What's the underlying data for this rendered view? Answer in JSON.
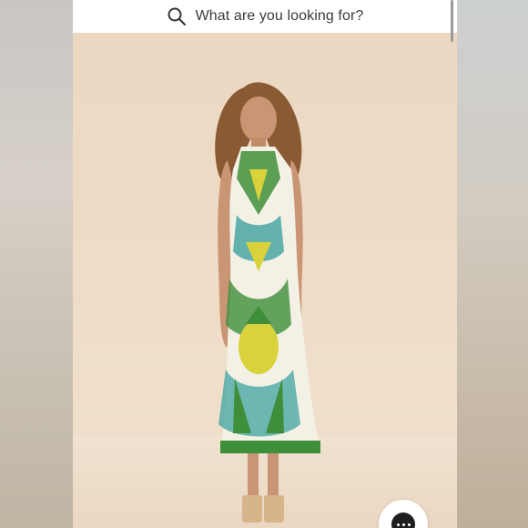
{
  "search": {
    "placeholder": "What are you looking for?"
  },
  "icons": {
    "search": "search-icon",
    "more": "more-options-icon"
  },
  "colors": {
    "backdrop": "#ecd8c2",
    "dress_green": "#3f8f3a",
    "dress_yellow": "#d9d23a",
    "dress_teal": "#3fa3a0"
  }
}
